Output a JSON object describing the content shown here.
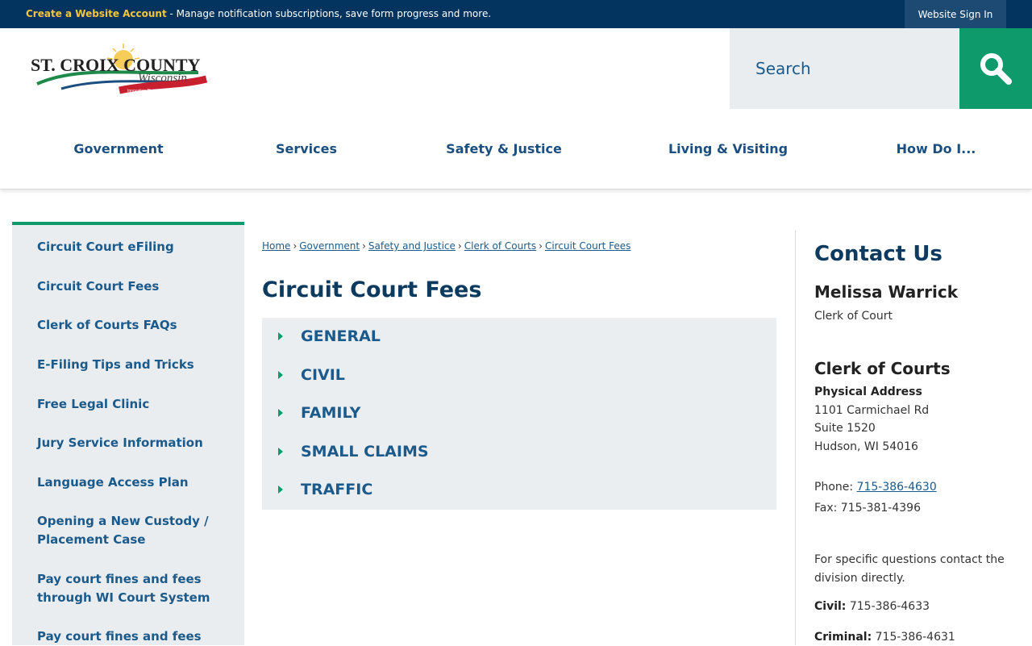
{
  "topbar": {
    "create_account_label": "Create a Website Account",
    "create_account_text": " - Manage notification subscriptions, save form progress and more.",
    "signin_label": "Website Sign In"
  },
  "header": {
    "logo_line1": "ST. CROIX COUNTY",
    "logo_line2": "Wisconsin",
    "logo_tagline": "Innovation Through Cooperation",
    "search_placeholder": "Search"
  },
  "nav": {
    "items": [
      "Government",
      "Services",
      "Safety & Justice",
      "Living & Visiting",
      "How Do I..."
    ]
  },
  "sidebar": {
    "items": [
      "Circuit Court eFiling",
      "Circuit Court Fees",
      "Clerk of Courts FAQs",
      "E-Filing Tips and Tricks",
      "Free Legal Clinic",
      "Jury Service Information",
      "Language Access Plan",
      "Opening a New Custody / Placement Case",
      "Pay court fines and fees through WI Court System",
      "Pay court fines and fees"
    ]
  },
  "breadcrumb": [
    "Home",
    "Government",
    "Safety and Justice",
    "Clerk of Courts",
    "Circuit Court Fees"
  ],
  "breadcrumb_separator": "›",
  "page": {
    "title": "Circuit Court Fees",
    "accordion": [
      "GENERAL",
      "CIVIL",
      "FAMILY",
      "SMALL CLAIMS",
      "TRAFFIC"
    ]
  },
  "contact": {
    "heading": "Contact Us",
    "name": "Melissa Warrick",
    "role": "Clerk of Court",
    "dept": "Clerk of Courts",
    "address_label": "Physical Address",
    "address_line1": "1101 Carmichael Rd",
    "address_line2": "Suite 1520",
    "address_line3": "Hudson, WI 54016",
    "phone_label": "Phone: ",
    "phone": "715-386-4630",
    "fax": "Fax: 715-381-4396",
    "note": "For specific questions contact the division directly.",
    "civil_label": "Civil:",
    "civil_phone": " 715-386-4633",
    "criminal_label": "Criminal:",
    "criminal_phone": " 715-386-4631"
  },
  "colors": {
    "topbar": "#03335f",
    "accent_green": "#0f9a6c",
    "link_blue": "#1b5a8a",
    "heading_navy": "#0d3a5f",
    "panel_gray": "#e9edf0"
  }
}
